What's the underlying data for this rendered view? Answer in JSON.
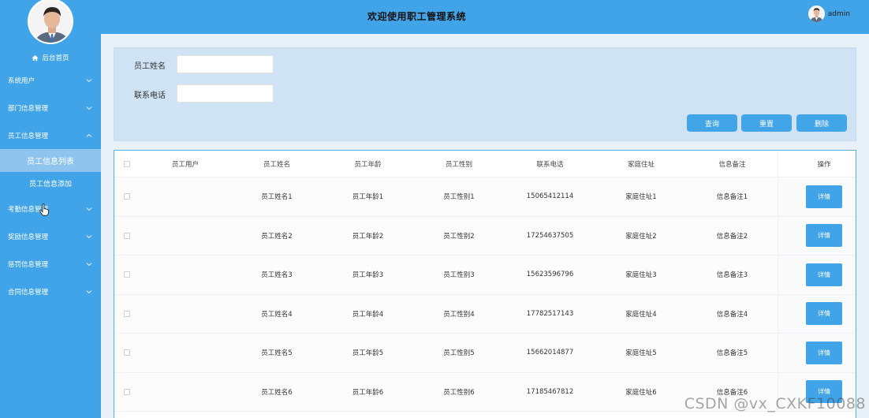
{
  "sidebar": {
    "home_label": "后台首页",
    "menu": [
      {
        "label": "系统用户",
        "chevron": "down"
      },
      {
        "label": "部门信息管理",
        "chevron": "down"
      },
      {
        "label": "员工信息管理",
        "chevron": "up",
        "children": [
          {
            "label": "员工信息列表",
            "active": true
          },
          {
            "label": "员工信息添加",
            "active": false
          }
        ]
      },
      {
        "label": "考勤信息管理",
        "chevron": "down"
      },
      {
        "label": "奖励信息管理",
        "chevron": "down"
      },
      {
        "label": "惩罚信息管理",
        "chevron": "down"
      },
      {
        "label": "合同信息管理",
        "chevron": "down"
      }
    ]
  },
  "header": {
    "title": "欢迎使用职工管理系统",
    "username": "admin"
  },
  "search": {
    "name_label": "员工姓名",
    "name_value": "",
    "phone_label": "联系电话",
    "phone_value": "",
    "query_label": "查询",
    "reset_label": "重置",
    "delete_label": "删除"
  },
  "table": {
    "headers": [
      "员工用户",
      "员工姓名",
      "员工年龄",
      "员工性别",
      "联系电话",
      "家庭住址",
      "信息备注",
      "操作"
    ],
    "rows": [
      {
        "user": "",
        "name": "员工姓名1",
        "age": "员工年龄1",
        "gender": "员工性别1",
        "phone": "15065412114",
        "address": "家庭住址1",
        "note": "信息备注1"
      },
      {
        "user": "",
        "name": "员工姓名2",
        "age": "员工年龄2",
        "gender": "员工性别2",
        "phone": "17254637505",
        "address": "家庭住址2",
        "note": "信息备注2"
      },
      {
        "user": "",
        "name": "员工姓名3",
        "age": "员工年龄3",
        "gender": "员工性别3",
        "phone": "15623596796",
        "address": "家庭住址3",
        "note": "信息备注3"
      },
      {
        "user": "",
        "name": "员工姓名4",
        "age": "员工年龄4",
        "gender": "员工性别4",
        "phone": "17782517143",
        "address": "家庭住址4",
        "note": "信息备注4"
      },
      {
        "user": "",
        "name": "员工姓名5",
        "age": "员工年龄5",
        "gender": "员工性别5",
        "phone": "15662014877",
        "address": "家庭住址5",
        "note": "信息备注5"
      },
      {
        "user": "",
        "name": "员工姓名6",
        "age": "员工年龄6",
        "gender": "员工性别6",
        "phone": "17185467812",
        "address": "家庭住址6",
        "note": "信息备注6"
      }
    ],
    "detail_label": "详情"
  },
  "watermark": "CSDN @vx_CXKF10088",
  "colors": {
    "primary": "#41a4e8",
    "active_submenu": "#8fc4ef",
    "search_panel": "#cfe3f5"
  }
}
